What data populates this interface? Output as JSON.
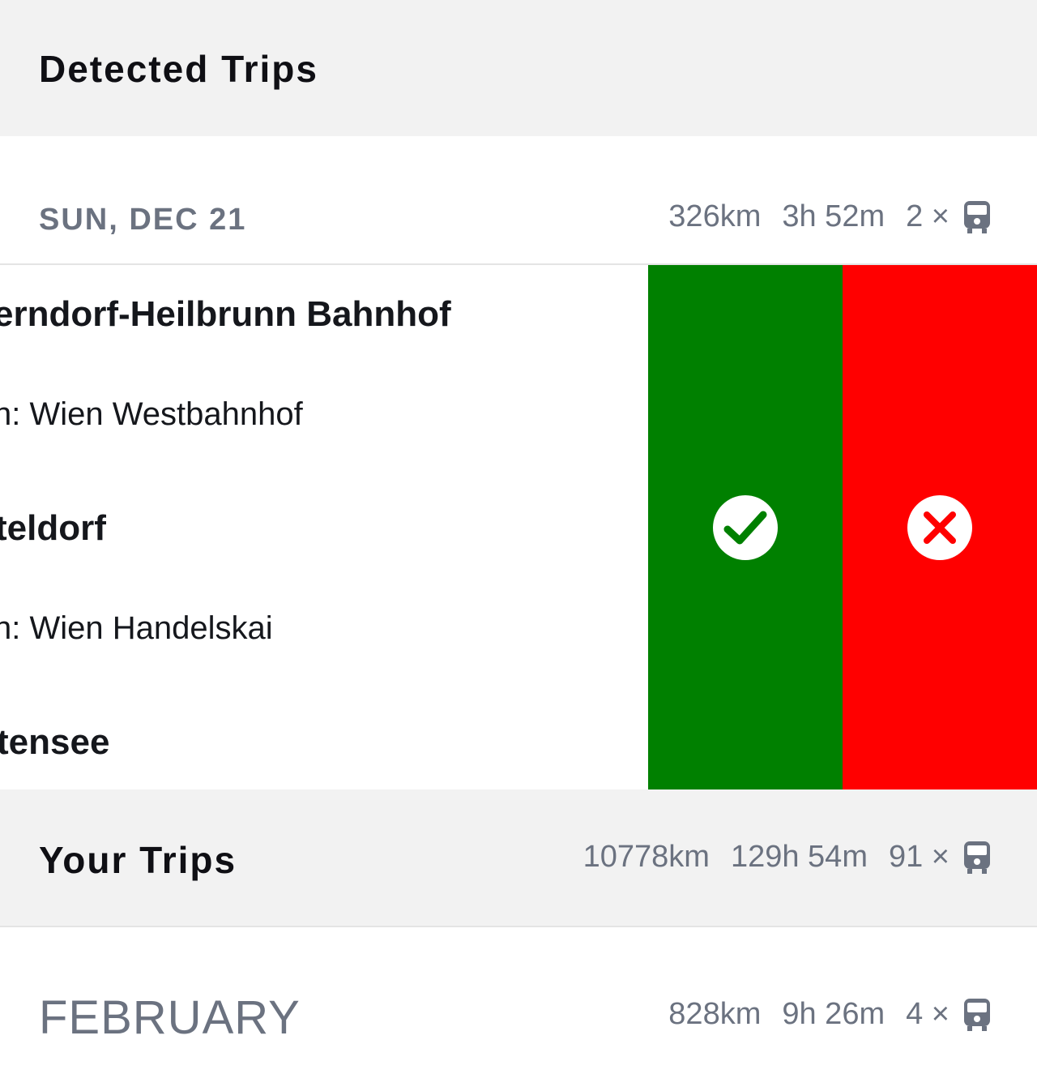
{
  "header": {
    "title": "Detected Trips"
  },
  "detected": {
    "day_label": "SUN, DEC 21",
    "distance": "326km",
    "duration": "3h 52m",
    "count": "2 ×",
    "transport_icon": "train-icon",
    "trip_lines": [
      "erndorf-Heilbrunn Bahnhof",
      "n: Wien Westbahnhof",
      "teldorf",
      "n: Wien Handelskai",
      "tensee"
    ]
  },
  "actions": {
    "accept_icon": "check-icon",
    "reject_icon": "close-icon",
    "accept_color": "#008000",
    "reject_color": "#ff0000"
  },
  "your_trips": {
    "title": "Your Trips",
    "distance": "10778km",
    "duration": "129h 54m",
    "count": "91 ×",
    "transport_icon": "train-icon"
  },
  "month": {
    "label": "FEBRUARY",
    "distance": "828km",
    "duration": "9h 26m",
    "count": "4 ×",
    "transport_icon": "train-icon"
  }
}
